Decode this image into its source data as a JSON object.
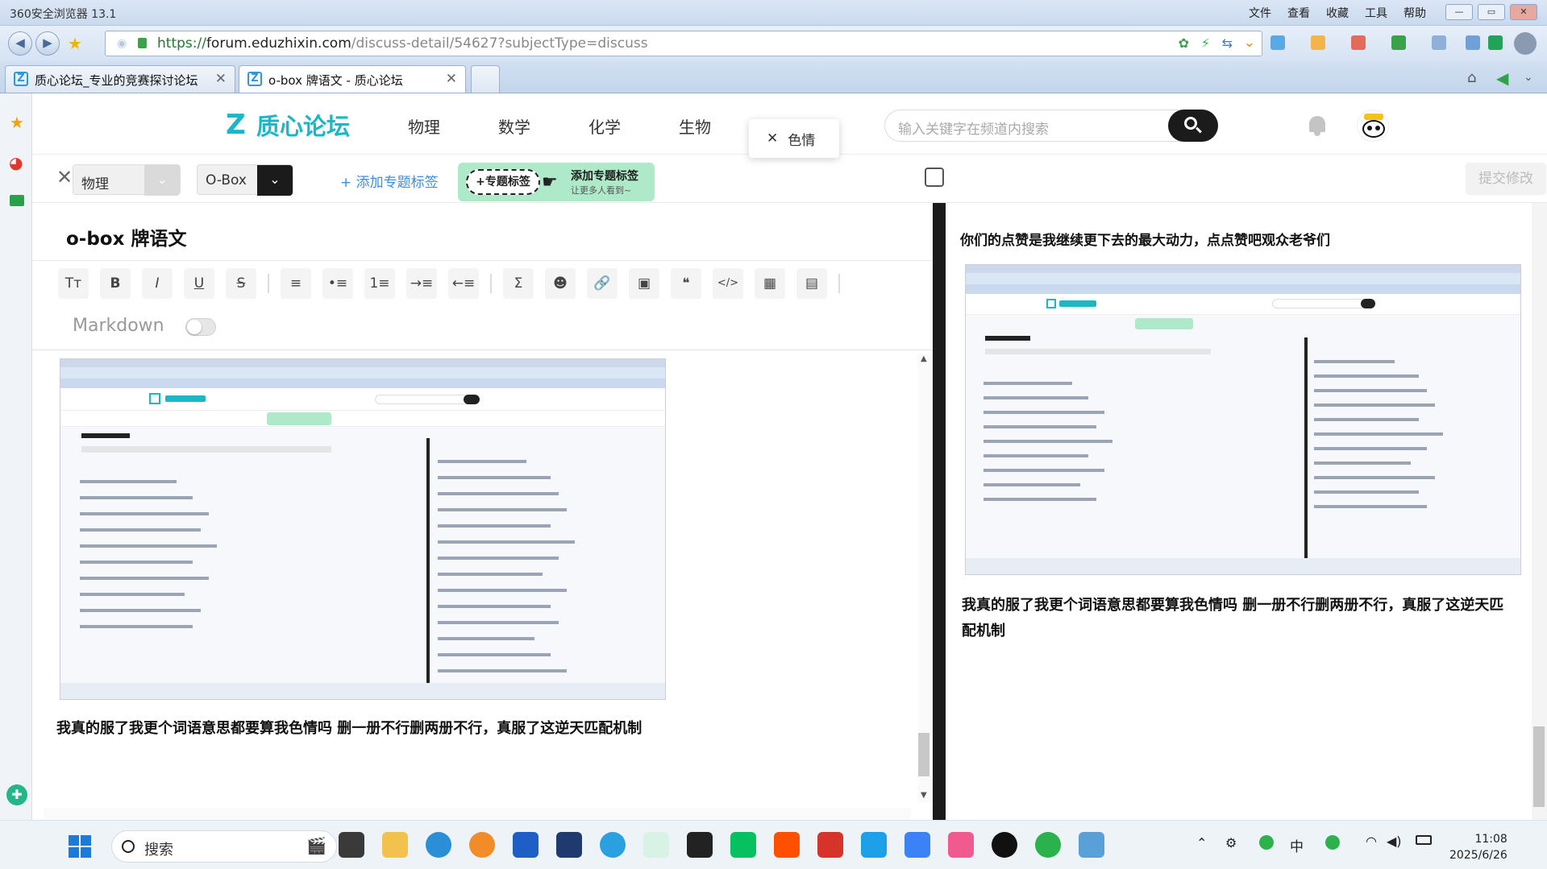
{
  "browser": {
    "title": "360安全浏览器 13.1",
    "menus": [
      "文件",
      "查看",
      "收藏",
      "工具",
      "帮助"
    ],
    "url_scheme": "https://",
    "url_host": "forum.eduzhixin.com",
    "url_path": "/discuss-detail/54627?subjectType=discuss",
    "tabs": [
      {
        "label": "质心论坛_专业的竞赛探讨论坛",
        "active": false
      },
      {
        "label": "o-box 牌语文 - 质心论坛",
        "active": true
      }
    ]
  },
  "site": {
    "logo_text": "质心论坛",
    "nav": [
      "物理",
      "数学",
      "化学",
      "生物"
    ],
    "search_placeholder": "输入关键字在频道内搜索"
  },
  "toast": {
    "text": "色情",
    "color": "#e9473f"
  },
  "editor": {
    "subject_select": "物理",
    "tag_select": "O-Box",
    "add_tag_label": "+ 添加专题标签",
    "banner_pill": "+专题标签",
    "banner_title": "添加专题标签",
    "banner_sub": "让更多人看到~",
    "submit_label": "提交修改",
    "post_title": "o-box 牌语文",
    "toolbar_icons": [
      "text-size-icon",
      "bold-icon",
      "italic-icon",
      "underline-icon",
      "strikethrough-icon",
      "align-icon",
      "bullet-list-icon",
      "numbered-list-icon",
      "indent-icon",
      "outdent-icon",
      "formula-icon",
      "emoji-icon",
      "link-icon",
      "image-icon",
      "quote-icon",
      "code-icon",
      "table-icon",
      "divider-icon"
    ],
    "toolbar_glyphs": [
      "Tт",
      "B",
      "I",
      "U",
      "S",
      "≡",
      "•≡",
      "1≡",
      "→≡",
      "←≡",
      "Σ",
      "☻",
      "🔗",
      "▣",
      "❝",
      "</>",
      "▦",
      "▤"
    ],
    "markdown_label": "Markdown",
    "markdown_enabled": false,
    "body_caption": "我真的服了我更个词语意思都要算我色情吗 删一册不行删两册不行，真服了这逆天匹配机制"
  },
  "preview": {
    "line1": "你们的点赞是我继续更下去的最大动力，点点赞吧观众老爷们",
    "line2": "我真的服了我更个词语意思都要算我色情吗 删一册不行删两册不行，真服了这逆天匹配机制"
  },
  "taskbar": {
    "search_label": "搜索",
    "ime": "中",
    "time": "11:08",
    "date": "2025/6/26"
  },
  "colors": {
    "brand": "#1bb7c6",
    "link": "#3a8ee6",
    "divider": "#1b1b1b"
  }
}
